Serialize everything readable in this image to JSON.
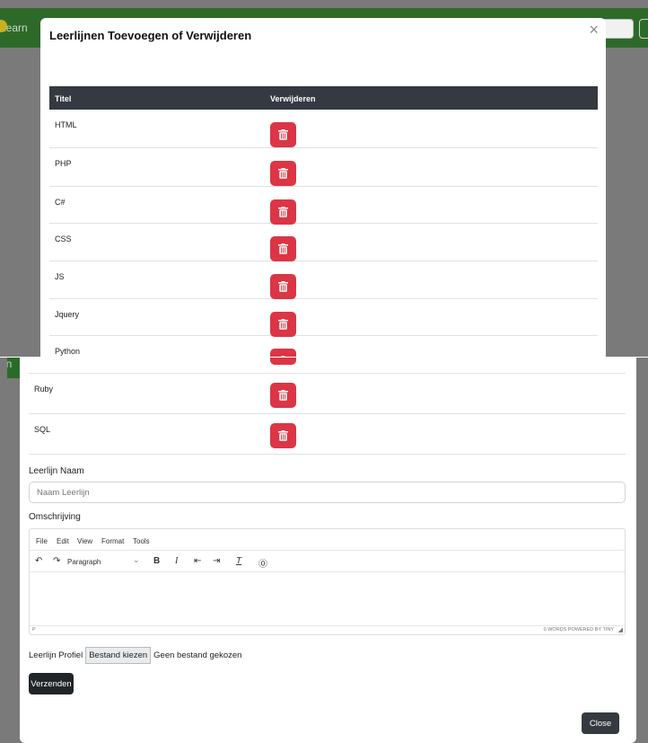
{
  "modal": {
    "title": "Leerlijnen Toevoegen of Verwijderen",
    "close_glyph": "×"
  },
  "navbar": {
    "brand": "Learn",
    "brand_cut": "arn"
  },
  "table": {
    "headers": [
      "Titel",
      "Verwijderen"
    ],
    "rows": [
      "HTML",
      "PHP",
      "C#",
      "CSS",
      "JS",
      "Jquery",
      "Python",
      "Ruby",
      "SQL"
    ],
    "delete_icon": "trash-icon"
  },
  "form": {
    "name_label": "Leerlijn Naam",
    "name_placeholder": "Naam Leerlijn",
    "description_label": "Omschrijving",
    "editor": {
      "menu": [
        "File",
        "Edit",
        "View",
        "Format",
        "Tools"
      ],
      "block_format": "Paragraph",
      "status_path": "P",
      "status_right": "0 WORDS  POWERED BY TINY"
    },
    "profile_label": "Leerlijn Profiel",
    "file_button": "Bestand kiezen",
    "file_status": "Geen bestand gekozen",
    "submit": "Verzenden"
  },
  "footer": {
    "close": "Close"
  },
  "colors": {
    "navbar": "#2d6a2a",
    "danger": "#dc3545",
    "dark": "#343a40"
  }
}
